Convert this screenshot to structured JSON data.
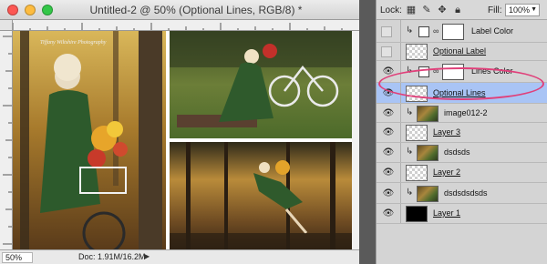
{
  "document": {
    "title": "Untitled-2 @ 50% (Optional Lines, RGB/8) *",
    "zoom": "50%",
    "doc_size": "Doc: 1.91M/16.2M",
    "watermark": "Tiffany Wiltshire Photography"
  },
  "layers_panel": {
    "lock_label": "Lock:",
    "fill_label": "Fill:",
    "fill_value": "100%",
    "layers": [
      {
        "name": "Label Color",
        "visible": false,
        "type": "solid-fill-clipped",
        "selected": false,
        "underlined": false
      },
      {
        "name": "Optional Label",
        "visible": false,
        "type": "transparent",
        "selected": false,
        "underlined": true
      },
      {
        "name": "Lines Color",
        "visible": true,
        "type": "solid-fill-clipped",
        "selected": false,
        "underlined": false
      },
      {
        "name": "Optional Lines",
        "visible": true,
        "type": "transparent",
        "selected": true,
        "underlined": true
      },
      {
        "name": "image012-2",
        "visible": true,
        "type": "photo-clipped",
        "selected": false,
        "underlined": false
      },
      {
        "name": "Layer 3",
        "visible": true,
        "type": "transparent",
        "selected": false,
        "underlined": true
      },
      {
        "name": "dsdsds",
        "visible": true,
        "type": "photo-clipped",
        "selected": false,
        "underlined": false
      },
      {
        "name": "Layer 2",
        "visible": true,
        "type": "transparent",
        "selected": false,
        "underlined": true
      },
      {
        "name": "dsdsdsdsds",
        "visible": true,
        "type": "photo-clipped",
        "selected": false,
        "underlined": false
      },
      {
        "name": "Layer 1",
        "visible": true,
        "type": "black",
        "selected": false,
        "underlined": true
      }
    ]
  },
  "colors": {
    "selection": "#a9c4f5",
    "annotation": "#e0407a"
  }
}
